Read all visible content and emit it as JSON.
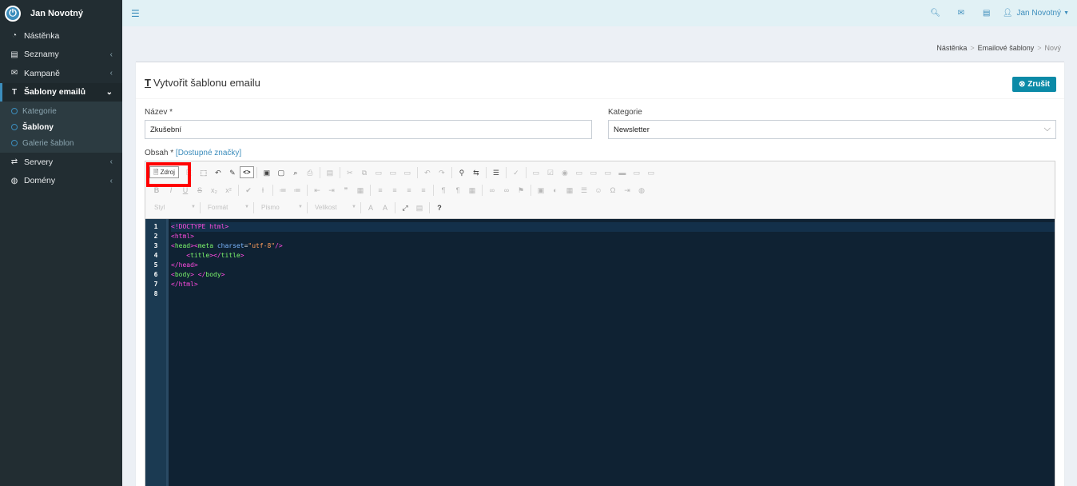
{
  "brand": {
    "name": "Jan Novotný",
    "logo_icon": "power-icon"
  },
  "sidebar": {
    "items": [
      {
        "label": "Nástěnka",
        "icon": "dashboard-icon",
        "chevron": ""
      },
      {
        "label": "Seznamy",
        "icon": "list-icon",
        "chevron": "‹"
      },
      {
        "label": "Kampaně",
        "icon": "envelope-icon",
        "chevron": "‹"
      },
      {
        "label": "Šablony emailů",
        "icon": "text-icon",
        "chevron": "›"
      },
      {
        "label": "Servery",
        "icon": "exchange-icon",
        "chevron": "‹"
      },
      {
        "label": "Domény",
        "icon": "globe-icon",
        "chevron": "‹"
      }
    ],
    "submenu": [
      {
        "label": "Kategorie"
      },
      {
        "label": "Šablony"
      },
      {
        "label": "Galerie šablon"
      }
    ]
  },
  "topbar": {
    "user": "Jan Novotný",
    "icons": [
      "search-icon",
      "envelope-icon",
      "server-icon",
      "user-icon"
    ]
  },
  "breadcrumb": {
    "items": [
      "Nástěnka",
      "Emailové šablony",
      "Nový"
    ]
  },
  "form": {
    "title": "Vytvořit šablonu emailu",
    "cancel_label": "Zrušit",
    "name_label": "Název *",
    "name_value": "Zkušební",
    "category_label": "Kategorie",
    "category_value": "Newsletter",
    "content_label": "Obsah *",
    "content_link": "[Dostupné značky]"
  },
  "editor": {
    "source_label": "Zdroj",
    "style_combo": "Styl",
    "format_combo": "Formát",
    "font_combo": "Písmo",
    "size_combo": "Velikost",
    "help_glyph": "?",
    "line_numbers": [
      "1",
      "2",
      "3",
      "4",
      "5",
      "6",
      "7",
      "8"
    ],
    "code_lines": [
      "<!DOCTYPE html>",
      "<html>",
      "<head><meta charset=\"utf-8\"/>",
      "    <title></title>",
      "</head>",
      "<body> </body>",
      "</html>",
      ""
    ]
  },
  "colors": {
    "sidebar_bg": "#222d32",
    "accent": "#3c8dbc",
    "cancel_bg": "#0b8aa7",
    "highlight": "#ff0000",
    "code_bg": "#0f2233"
  }
}
